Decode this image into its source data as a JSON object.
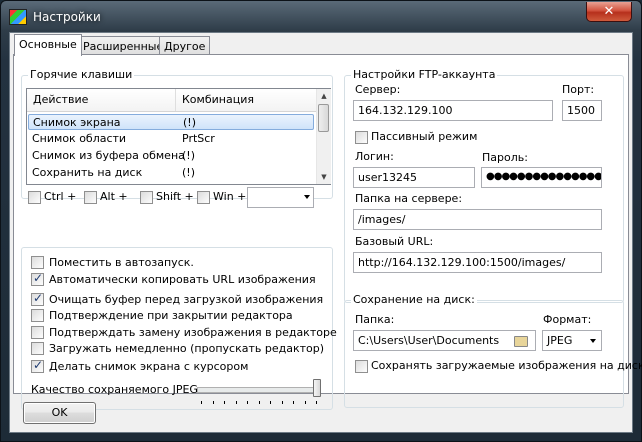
{
  "window": {
    "title": "Настройки",
    "close_glyph": "✕"
  },
  "tabs": [
    "Основные",
    "Расширенные",
    "Другое"
  ],
  "hotkeys": {
    "legend": "Горячие клавиши",
    "columns": [
      "Действие",
      "Комбинация"
    ],
    "rows": [
      {
        "action": "Снимок экрана",
        "combo": "(!)"
      },
      {
        "action": "Снимок области",
        "combo": "PrtScr"
      },
      {
        "action": "Снимок из буфера обмена",
        "combo": "(!)"
      },
      {
        "action": "Сохранить на диск",
        "combo": "(!)"
      }
    ],
    "modifiers": [
      "Ctrl +",
      "Alt +",
      "Shift +",
      "Win +"
    ],
    "key_value": ""
  },
  "options": {
    "items": [
      {
        "label": "Поместить в автозапуск.",
        "checked": false
      },
      {
        "label": "Автоматически копировать URL изображения",
        "checked": true
      },
      {
        "label": "Очищать буфер перед загрузкой изображения",
        "checked": true
      },
      {
        "label": "Подтверждение при закрытии редактора",
        "checked": false
      },
      {
        "label": "Подтверждать замену изображения в редакторе",
        "checked": false
      },
      {
        "label": "Загружать немедленно (пропускать редактор)",
        "checked": false
      },
      {
        "label": "Делать снимок экрана с курсором",
        "checked": true
      }
    ],
    "jpeg_quality_label": "Качество сохраняемого JPEG:",
    "jpeg_quality_fraction": 1.0
  },
  "ftp": {
    "legend": "Настройки FTP-аккаунта",
    "server_label": "Сервер:",
    "server": "164.132.129.100",
    "port_label": "Порт:",
    "port": "1500",
    "passive_label": "Пассивный режим",
    "login_label": "Логин:",
    "login": "user13245",
    "password_label": "Пароль:",
    "password": "●●●●●●●●●●●●●●●",
    "folder_label": "Папка на сервере:",
    "folder": "/images/",
    "base_url_label": "Базовый URL:",
    "base_url": "http://164.132.129.100:1500/images/"
  },
  "save": {
    "legend": "Сохранение на диск:",
    "folder_label": "Папка:",
    "folder": "C:\\Users\\User\\Documents",
    "format_label": "Формат:",
    "format": "JPEG",
    "keep_label": "Сохранять загружаемые изображения на диск"
  },
  "ok_label": "OK"
}
